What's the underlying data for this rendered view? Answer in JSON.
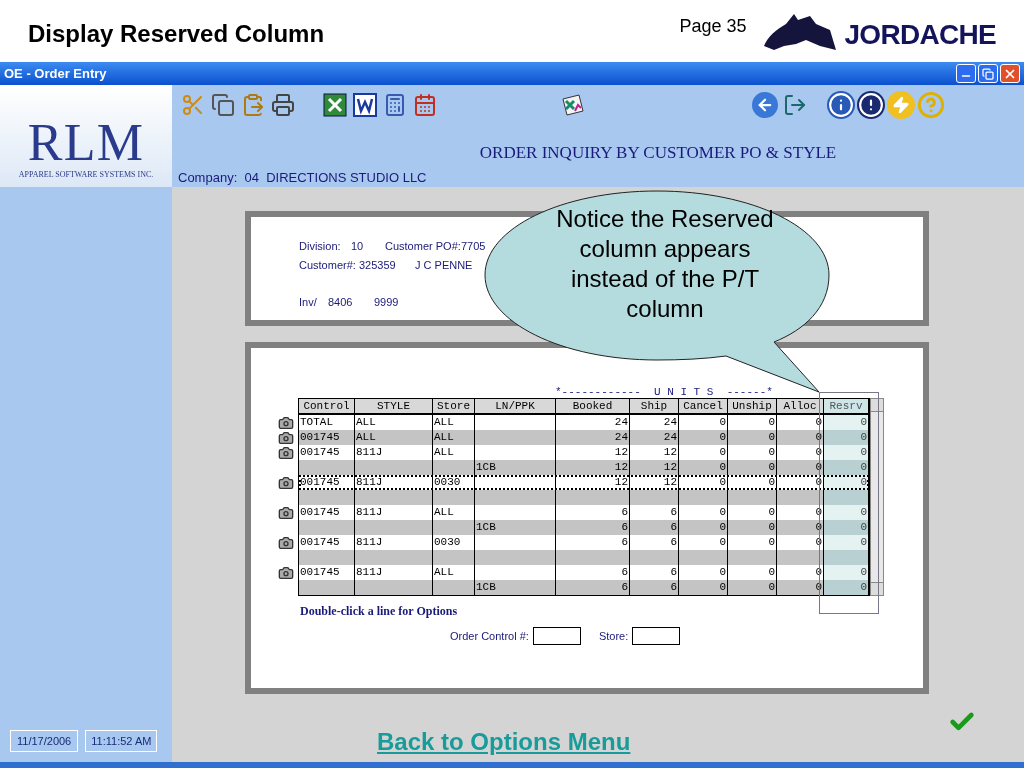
{
  "slide": {
    "title": "Display Reserved Column",
    "page": "Page 35",
    "brand": "JORDACHE"
  },
  "window": {
    "title": "OE - Order Entry"
  },
  "logo": {
    "name": "RLM",
    "tagline": "APPAREL SOFTWARE SYSTEMS INC."
  },
  "screen": {
    "title": "ORDER INQUIRY BY CUSTOMER PO & STYLE",
    "company": "Company:  04  DIRECTIONS STUDIO LLC"
  },
  "header": {
    "division_label": "Division:",
    "division": "10",
    "po_label": "Customer PO#:",
    "po": "7705",
    "customer_label": "Customer#:",
    "customer": "325359",
    "customer_name": "J C PENNE",
    "inv_label": "Inv/",
    "inv_1": "8406",
    "inv_2": "9999"
  },
  "units_caption": "*------------  U N I T S  ------*",
  "columns": [
    "Control",
    "STYLE",
    "Store",
    "LN/PPK",
    "Booked",
    "Ship",
    "Cancel",
    "Unship",
    "Alloc",
    "Resrv"
  ],
  "rows": [
    {
      "icon": true,
      "selected": false,
      "cells": [
        "TOTAL",
        "ALL",
        "ALL",
        "",
        "24",
        "24",
        "0",
        "0",
        "0",
        "0"
      ]
    },
    {
      "icon": true,
      "selected": false,
      "cells": [
        "001745",
        "ALL",
        "ALL",
        "",
        "24",
        "24",
        "0",
        "0",
        "0",
        "0"
      ]
    },
    {
      "icon": true,
      "selected": false,
      "cells": [
        "001745",
        "811J",
        "ALL",
        "",
        "12",
        "12",
        "0",
        "0",
        "0",
        "0"
      ]
    },
    {
      "icon": false,
      "selected": false,
      "cells": [
        "",
        "",
        "",
        "1CB",
        "12",
        "12",
        "0",
        "0",
        "0",
        "0"
      ]
    },
    {
      "icon": true,
      "selected": true,
      "cells": [
        "001745",
        "811J",
        "0030",
        "",
        "12",
        "12",
        "0",
        "0",
        "0",
        "0"
      ]
    },
    {
      "icon": false,
      "selected": false,
      "cells": []
    },
    {
      "icon": true,
      "selected": false,
      "cells": [
        "001745",
        "811J",
        "ALL",
        "",
        "6",
        "6",
        "0",
        "0",
        "0",
        "0"
      ]
    },
    {
      "icon": false,
      "selected": false,
      "cells": [
        "",
        "",
        "",
        "1CB",
        "6",
        "6",
        "0",
        "0",
        "0",
        "0"
      ]
    },
    {
      "icon": true,
      "selected": false,
      "cells": [
        "001745",
        "811J",
        "0030",
        "",
        "6",
        "6",
        "0",
        "0",
        "0",
        "0"
      ]
    },
    {
      "icon": false,
      "selected": false,
      "cells": []
    },
    {
      "icon": true,
      "selected": false,
      "cells": [
        "001745",
        "811J",
        "ALL",
        "",
        "6",
        "6",
        "0",
        "0",
        "0",
        "0"
      ]
    },
    {
      "icon": false,
      "selected": false,
      "cells": [
        "",
        "",
        "",
        "1CB",
        "6",
        "6",
        "0",
        "0",
        "0",
        "0"
      ]
    }
  ],
  "hint": "Double-click a line for Options",
  "fields": [
    {
      "label": "Order Control #:"
    },
    {
      "label": "Store:"
    }
  ],
  "callout": "Notice the Reserved column appears instead of the P/T column",
  "link": "Back to Options Menu",
  "status": {
    "date": "11/17/2006",
    "time": "11:11:52 AM"
  }
}
